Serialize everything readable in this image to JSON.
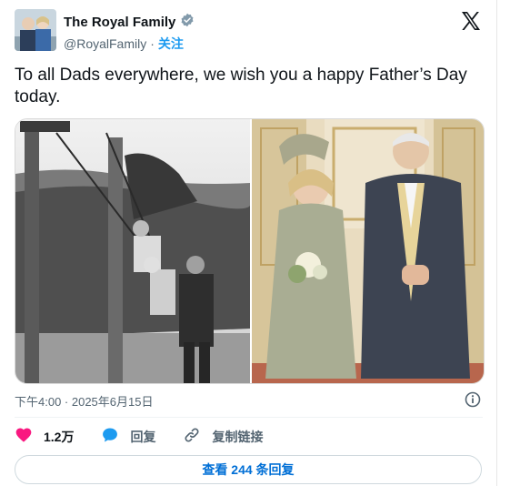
{
  "author": {
    "name": "The Royal Family",
    "handle": "@RoyalFamily",
    "separator": "·",
    "follow_label": "关注"
  },
  "tweet": {
    "text": "To all Dads everywhere, we wish you a happy Father’s Day today.",
    "timestamp": "下午4:00 · 2025年6月15日"
  },
  "icons": {
    "verified": "verified-badge-icon",
    "x_logo": "x-logo-icon",
    "info": "info-icon",
    "like": "heart-icon",
    "reply": "reply-bubble-icon",
    "copy": "link-icon"
  },
  "actions": {
    "likes": "1.2万",
    "reply_label": "回复",
    "copy_link_label": "复制链接"
  },
  "replies_button": "查看 244 条回复",
  "colors": {
    "accent": "#1d9bf0",
    "like": "#f91880",
    "verified": "#829aab",
    "link_text": "#006fd6"
  }
}
